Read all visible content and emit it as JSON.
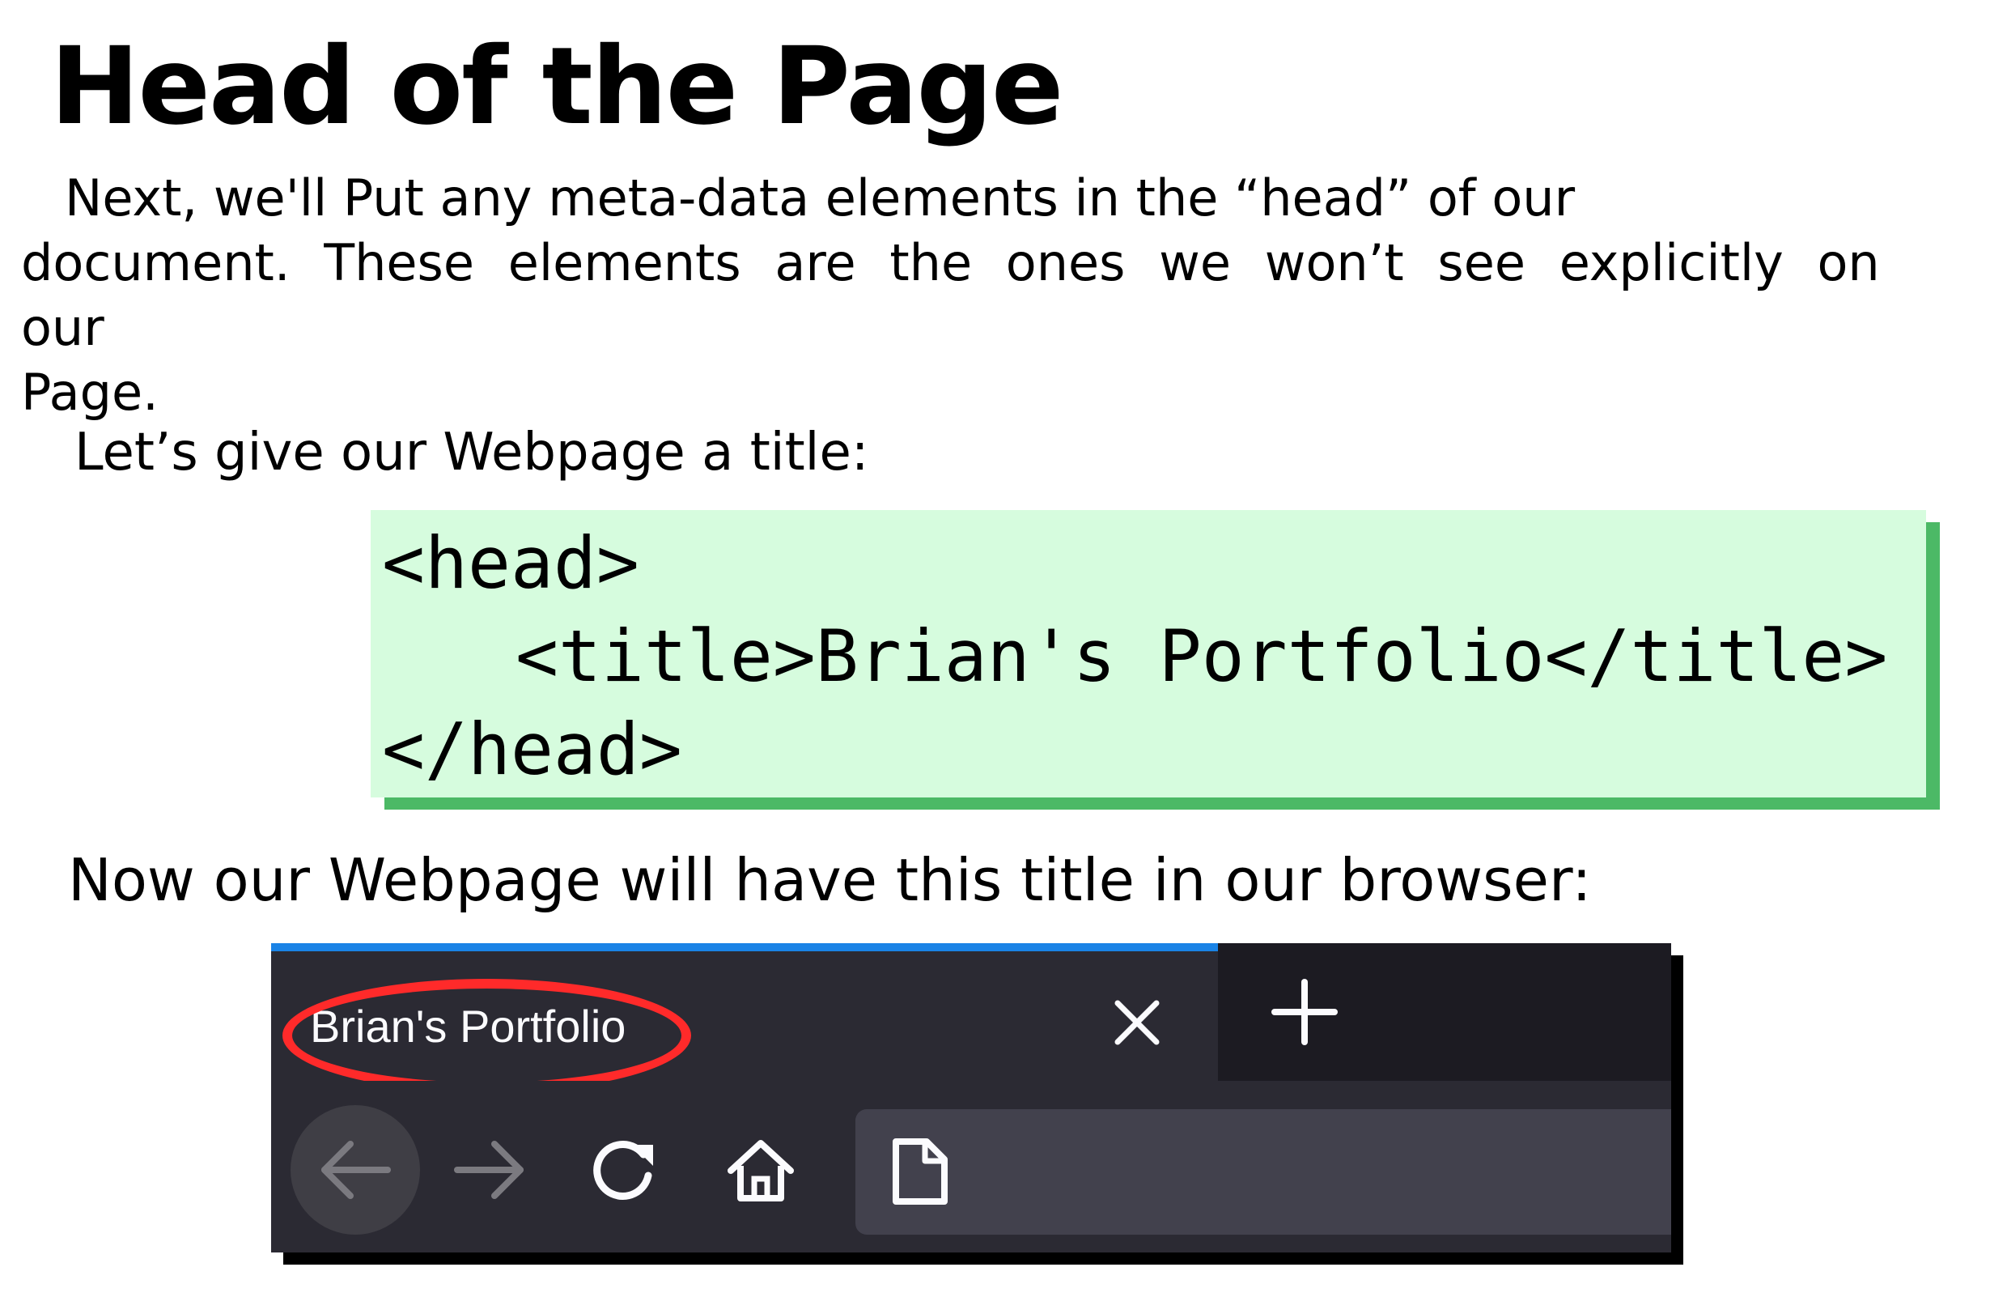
{
  "heading": "Head of the Page",
  "intro_paragraph": {
    "line1": "Next, we'll Put any meta-data elements in the “head” of our",
    "line2": "document. These elements are the ones we won’t see explicitly on our",
    "line3": "Page."
  },
  "title_intro": "Let’s give our Webpage a title:",
  "code": {
    "line1": "<head>",
    "line2": "<title>Brian's Portfolio</title>",
    "line3": "</head>"
  },
  "browser_intro": "Now our Webpage will have this title in our browser:",
  "browser": {
    "tab_title": "Brian's Portfolio",
    "icons": [
      "close-icon",
      "plus-icon",
      "back-arrow-icon",
      "forward-arrow-icon",
      "reload-icon",
      "home-icon",
      "page-icon"
    ]
  },
  "colors": {
    "code_background": "#d6fcde",
    "code_shadow": "#4cb966",
    "highlight": "#ff2a2a",
    "tab_accent": "#1a83e6",
    "browser_dark": "#2b2a33"
  }
}
